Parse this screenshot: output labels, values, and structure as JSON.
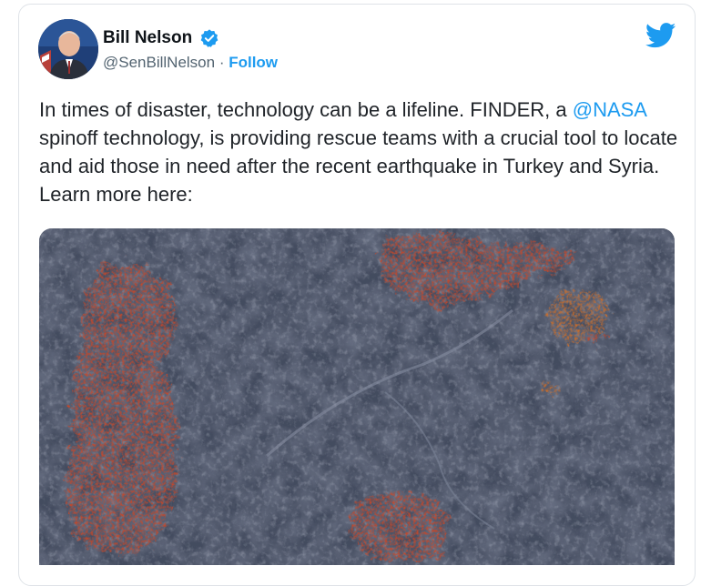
{
  "author": {
    "name": "Bill Nelson",
    "handle": "@SenBillNelson",
    "separator": " · ",
    "follow_label": "Follow",
    "verified": true
  },
  "tweet": {
    "text_part1": "In times of disaster, technology can be a lifeline. FINDER, a ",
    "mention": "@NASA",
    "text_part2": " spinoff technology, is providing rescue teams with a crucial tool to locate and aid those in need after the recent earthquake in Turkey and Syria. Learn more here:"
  },
  "media": {
    "type": "satellite-image",
    "description_icon": "satellite-terrain-image"
  },
  "icons": {
    "brand": "twitter-bird-icon",
    "verified": "verified-badge-icon"
  },
  "colors": {
    "accent": "#1d9bf0",
    "text": "#1f2328",
    "secondary_text": "#536471",
    "damage_overlay": "#e2502c"
  }
}
